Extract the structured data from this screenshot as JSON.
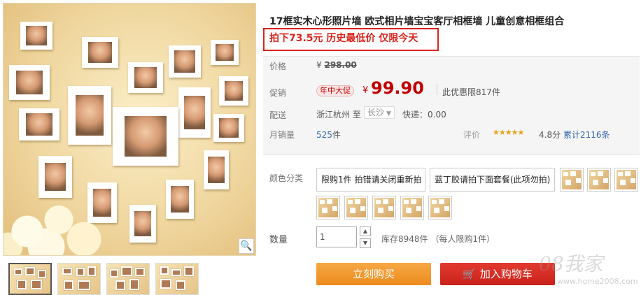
{
  "product": {
    "title": "17框实木心形照片墙 欧式相片墙宝宝客厅相框墙 儿童创意相框组合",
    "promo": "拍下73.5元 历史最低价 仅限今天"
  },
  "price": {
    "label": "价格",
    "currency": "¥",
    "original": "298.00"
  },
  "promotion": {
    "label": "促销",
    "badge": "年中大促",
    "currency": "¥",
    "price": "99.90",
    "limit": "此优惠限817件"
  },
  "shipping": {
    "label": "配送",
    "from": "浙江杭州 至",
    "to": "长沙",
    "fee": "快递：0.00"
  },
  "sales": {
    "label": "月销量",
    "count": "525",
    "unit": "件",
    "rating_label": "评价",
    "stars": "★★★★★",
    "score": "4.8分",
    "reviews": "累计2116条"
  },
  "options": {
    "label": "颜色分类",
    "text_items": [
      "限购1件 拍错请关闭重新拍",
      "蓝丁胶请拍下面套餐(此项勿拍)"
    ]
  },
  "quantity": {
    "label": "数量",
    "value": "1",
    "up": "▲",
    "down": "▼",
    "stock": "库存8948件 （每人限购1件）"
  },
  "actions": {
    "buy_now": "立刻购买",
    "add_cart": "加入购物车"
  },
  "watermark": {
    "text": "08我家",
    "url": "www.home2008.com"
  },
  "icons": {
    "zoom": "🔍",
    "cart": "🛒"
  },
  "colors": {
    "accent_red": "#c40000",
    "promo_red": "#d9241b",
    "buy_orange": "#f39b2f",
    "cart_red": "#d62c22"
  }
}
